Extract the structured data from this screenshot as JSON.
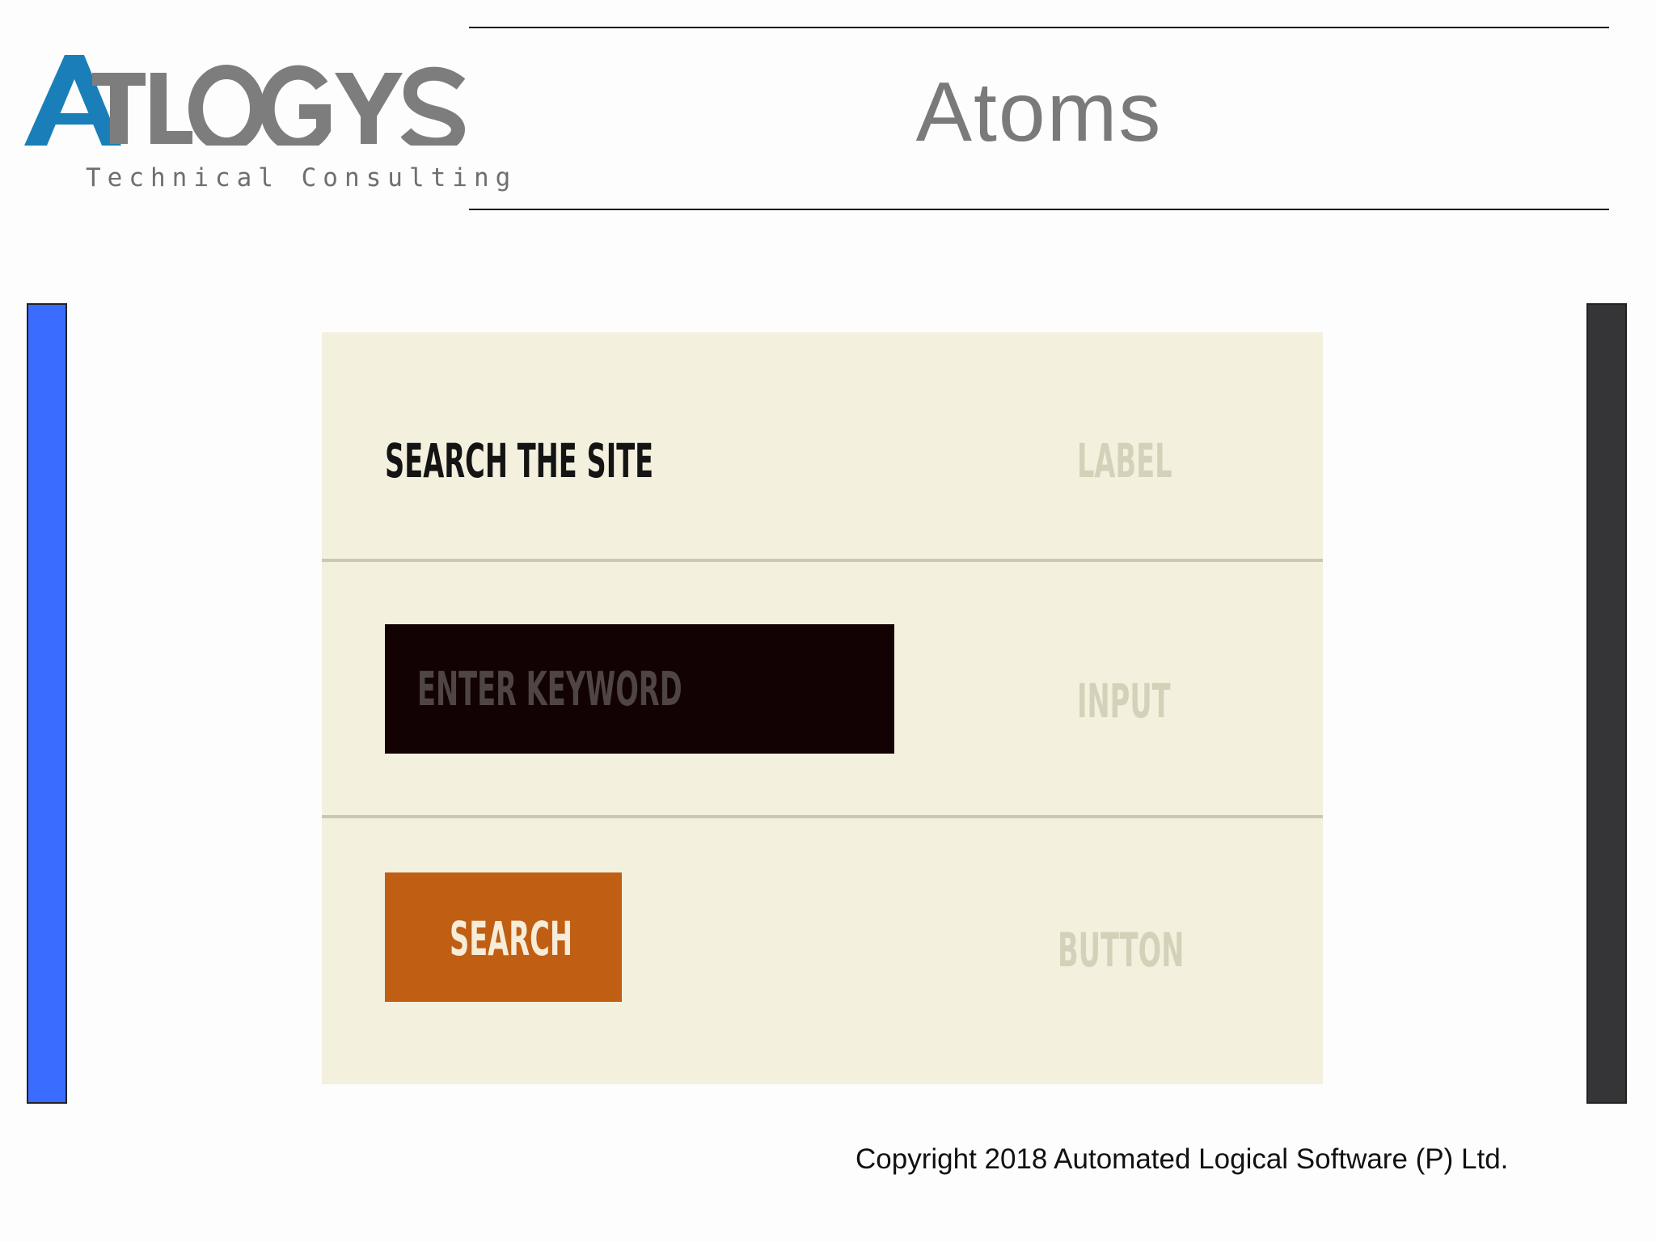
{
  "logo": {
    "wordmark": "ATLOGYS",
    "tagline": "Technical Consulting"
  },
  "slide": {
    "title": "Atoms",
    "copyright": "Copyright 2018 Automated Logical Software (P) Ltd."
  },
  "atoms": {
    "label_row": {
      "text": "SEARCH THE SITE",
      "atom_name": "LABEL"
    },
    "input_row": {
      "placeholder": "ENTER KEYWORD",
      "atom_name": "INPUT"
    },
    "button_row": {
      "button_label": "SEARCH",
      "atom_name": "BUTTON"
    }
  },
  "colors": {
    "logo_blue": "#1a7fb8",
    "logo_gray": "#7d7d7d",
    "left_bar": "#3a6cff",
    "right_bar": "#353437",
    "panel_background": "#f4f0de",
    "input_background": "#120204",
    "button_background": "#c05f14"
  }
}
